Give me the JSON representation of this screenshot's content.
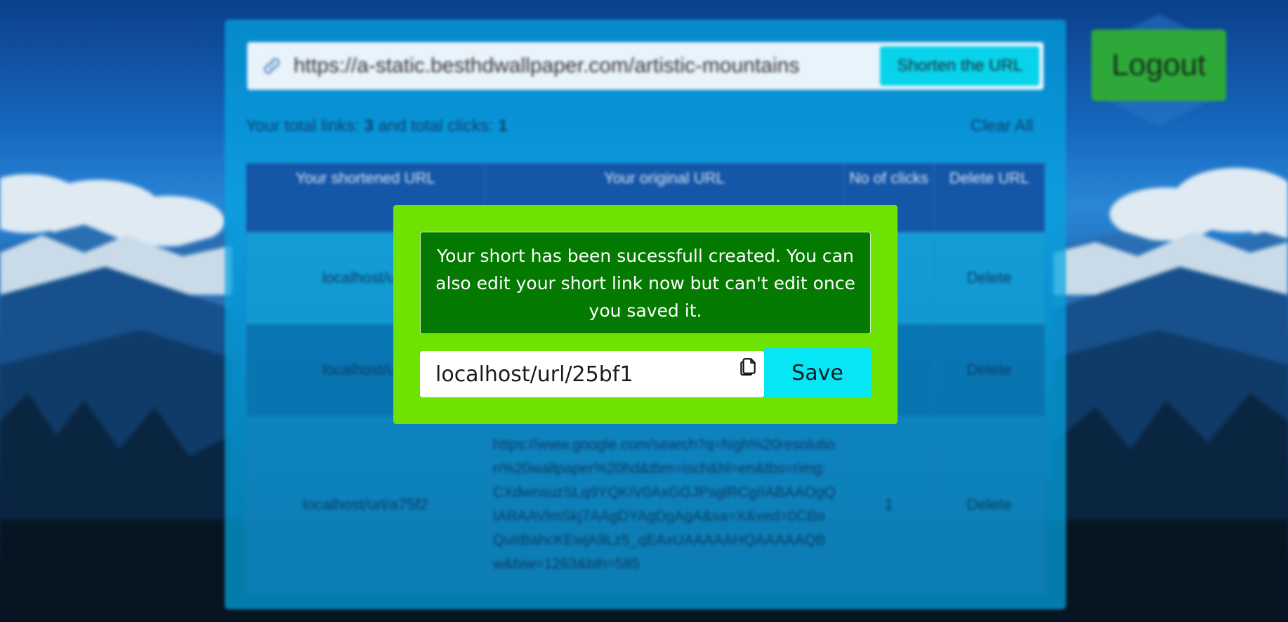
{
  "url_bar": {
    "value": "https://a-static.besthdwallpaper.com/artistic-mountains",
    "shorten_label": "Shorten the URL"
  },
  "logout_label": "Logout",
  "stats": {
    "prefix": "Your total links: ",
    "total_links": "3",
    "middle": " and total clicks: ",
    "total_clicks": "1",
    "clear_all_label": "Clear All"
  },
  "table": {
    "headers": [
      "Your shortened URL",
      "Your original URL",
      "No of clicks",
      "Delete URL"
    ],
    "rows": [
      {
        "short": "localhost/url/",
        "original": "",
        "clicks": "",
        "delete": "Delete"
      },
      {
        "short": "localhost/url/",
        "original": "",
        "clicks": "",
        "delete": "Delete"
      },
      {
        "short": "localhost/url/a75f2",
        "original": "https://www.google.com/search?q=high%20resolution%20wallpaper%20hd&tbm=isch&hl=en&tbs=rimg:CXdwnsuzSLq9YQKIV0AxGGJPsglRCgIIABAAOgQIARAAVlmSkj7AAgDYAgDgAgA&sa=X&ved=0CBoQuIIBahcKEwjA9Lz5_qEAxUAAAAAHQAAAAAQBw&biw=1263&bih=585",
        "clicks": "1",
        "delete": "Delete"
      }
    ]
  },
  "modal": {
    "message": "Your short has been sucessfull created. You can also edit your short link now but can't edit once you saved it.",
    "short_link_value": "localhost/url/25bf1",
    "save_label": "Save"
  },
  "colors": {
    "modal_bg": "#6ee200",
    "notice_bg": "#047a00",
    "save_button": "#06e6f4",
    "logout_button": "#2fa83a",
    "panel": "#04a5e1"
  },
  "icons": {
    "url_bar": "link-icon",
    "short_input": "copy-icon"
  }
}
